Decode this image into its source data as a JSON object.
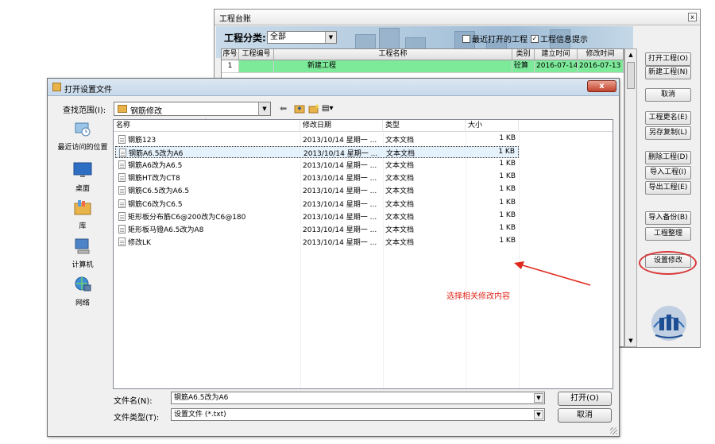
{
  "background_window": {
    "title": "工程台账",
    "close_glyph": "x",
    "filter_label": "工程分类:",
    "filter_value": "全部",
    "check_recent": {
      "label": "最近打开的工程",
      "checked": false
    },
    "check_info": {
      "label": "工程信息提示",
      "checked": true
    },
    "grid_headers": [
      "序号",
      "工程编号",
      "工程名称",
      "类别",
      "建立时间",
      "修改时间"
    ],
    "grid_rows": [
      {
        "no": "1",
        "code": "",
        "name": "新建工程",
        "type": "砼算",
        "created": "2016-07-14",
        "modified": "2016-07-13"
      }
    ],
    "buttons": {
      "open": "打开工程(O)",
      "new": "新建工程(N)",
      "cancel": "取消",
      "rename": "工程更名(E)",
      "save_as": "另存复制(L)",
      "delete": "删除工程(D)",
      "import": "导入工程(I)",
      "export": "导出工程(E)",
      "restore": "导入备份(B)",
      "tidy": "工程整理",
      "modify_settings": "设置修改"
    }
  },
  "dialog": {
    "title": "打开设置文件",
    "close_glyph": "x",
    "look_in_label": "查找范围(I):",
    "look_in_value": "钢筋修改",
    "view_menu_glyph": "▤▾",
    "places": [
      "最近访问的位置",
      "桌面",
      "库",
      "计算机",
      "网络"
    ],
    "columns": [
      "名称",
      "修改日期",
      "类型",
      "大小"
    ],
    "files": [
      {
        "name": "钢筋123",
        "date": "2013/10/14 星期一 ...",
        "type": "文本文档",
        "size": "1 KB",
        "selected": false
      },
      {
        "name": "钢筋A6.5改为A6",
        "date": "2013/10/14 星期一 ...",
        "type": "文本文档",
        "size": "1 KB",
        "selected": true
      },
      {
        "name": "钢筋A6改为A6.5",
        "date": "2013/10/14 星期一 ...",
        "type": "文本文档",
        "size": "1 KB",
        "selected": false
      },
      {
        "name": "钢筋HT改为CT8",
        "date": "2013/10/14 星期一 ...",
        "type": "文本文档",
        "size": "1 KB",
        "selected": false
      },
      {
        "name": "钢筋C6.5改为A6.5",
        "date": "2013/10/14 星期一 ...",
        "type": "文本文档",
        "size": "1 KB",
        "selected": false
      },
      {
        "name": "钢筋C6改为C6.5",
        "date": "2013/10/14 星期一 ...",
        "type": "文本文档",
        "size": "1 KB",
        "selected": false
      },
      {
        "name": "矩形板分布筋C6@200改为C6@180",
        "date": "2013/10/14 星期一 ...",
        "type": "文本文档",
        "size": "1 KB",
        "selected": false
      },
      {
        "name": "矩形板马镫A6.5改为A8",
        "date": "2013/10/14 星期一 ...",
        "type": "文本文档",
        "size": "1 KB",
        "selected": false
      },
      {
        "name": "修改LK",
        "date": "2013/10/14 星期一 ...",
        "type": "文本文档",
        "size": "1 KB",
        "selected": false
      }
    ],
    "annotation": "选择相关修改内容",
    "filename_label": "文件名(N):",
    "filename_value": "钢筋A6.5改为A6",
    "filetype_label": "文件类型(T):",
    "filetype_value": "设置文件 (*.txt)",
    "open_button": "打开(O)",
    "cancel_button": "取消"
  },
  "colors": {
    "selected_project_row": "#7dea9a",
    "annotation_red": "#e0281c",
    "selection_blue": "#e5f1fb"
  }
}
